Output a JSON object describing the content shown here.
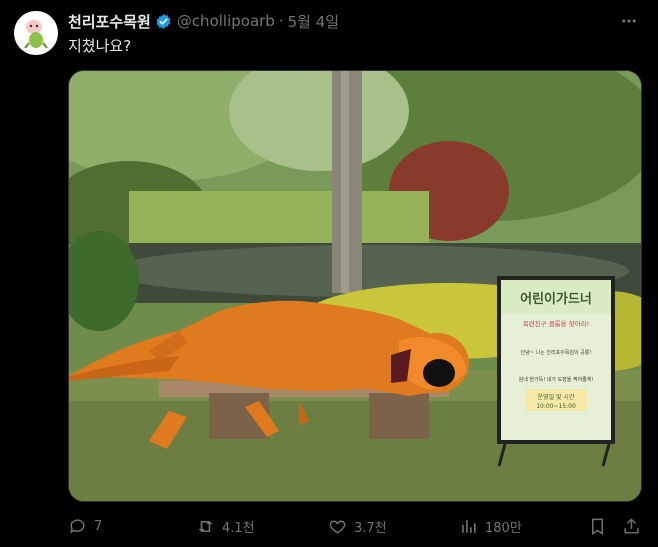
{
  "post": {
    "author_name": "천리포수목원",
    "handle": "@chollipoarb",
    "separator": "·",
    "date": "5월 4일",
    "text": "지쳤나요?",
    "avatar_icon": "tree-mascot-avatar",
    "verified_color": "#1d9bf0"
  },
  "sign": {
    "title": "어린이가드너",
    "subtitle": "목련친구 클롭을 찾아라!",
    "body_line": "안녕~ 나는 천리포수목원의 공룡!",
    "highlight": "원내 한가득! 내가 도장을 찍어줄게!",
    "hours_title": "운영일 및 시간",
    "hours": "10:00~15:00"
  },
  "actions": {
    "replies": "7",
    "reposts": "4.1천",
    "likes": "3.7천",
    "views": "180만"
  },
  "colors": {
    "background": "#000000",
    "text": "#e7e9ea",
    "muted": "#71767b"
  }
}
